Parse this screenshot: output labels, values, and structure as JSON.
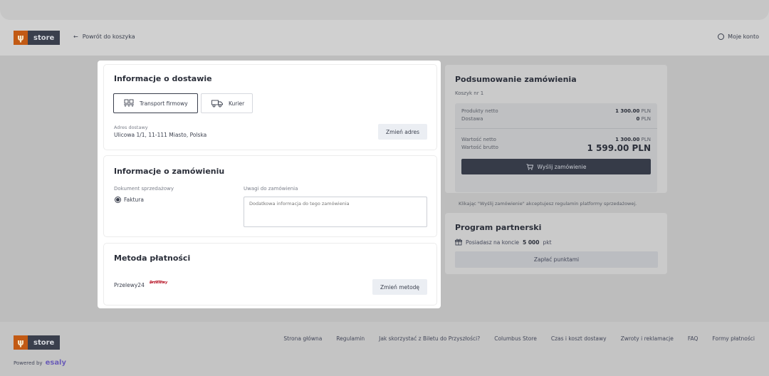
{
  "header": {
    "logo_text": "store",
    "back_label": "Powrót do koszyka",
    "account_label": "Moje konto"
  },
  "delivery": {
    "title": "Informacje o dostawie",
    "options": [
      {
        "label": "Transport firmowy",
        "selected": true,
        "icon": "pallet-icon"
      },
      {
        "label": "Kurier",
        "selected": false,
        "icon": "truck-icon"
      }
    ],
    "address_label": "Adres dostawy",
    "address_value": "Ulicowa 1/1, 11-111 Miasto, Polska",
    "change_address": "Zmień adres"
  },
  "order_info": {
    "title": "Informacje o zamówieniu",
    "doc_label": "Dokument sprzedażowy",
    "doc_value": "Faktura",
    "notes_label": "Uwagi do zamówienia",
    "notes_placeholder": "Dodatkowa informacja do tego zamówienia"
  },
  "payment": {
    "title": "Metoda płatności",
    "method": "Przelewy24",
    "method_logo_text": "Przelewy",
    "change_method": "Zmień metodę"
  },
  "summary": {
    "title": "Podsumowanie zamówienia",
    "cart_label": "Koszyk nr 1",
    "net_label": "Produkty netto",
    "net_amount": "1 300.00",
    "net_currency": "PLN",
    "delivery_label": "Dostawa",
    "delivery_amount": "0",
    "delivery_currency": "PLN",
    "total_net_label": "Wartość netto",
    "total_net_amount": "1 300.00",
    "total_net_currency": "PLN",
    "total_gross_label": "Wartość brutto",
    "total_gross": "1 599.00 PLN",
    "send_button": "Wyślij zamówienie",
    "terms_text": "Klikając \"Wyślij zamówienie\" akceptujesz regulamin platformy sprzedażowej."
  },
  "partner": {
    "title": "Program partnerski",
    "points_prefix": "Posiadasz na koncie",
    "points_value": "5 000",
    "points_unit": "pkt",
    "pay_button": "Zapłać punktami"
  },
  "footer": {
    "logo_text": "store",
    "powered_label": "Powered by",
    "powered_brand": "esaly",
    "links": [
      "Strona główna",
      "Regulamin",
      "Jak skorzystać z Biletu do Przyszłości?",
      "Columbus Store",
      "Czas i koszt dostawy",
      "Zwroty i reklamacje",
      "FAQ",
      "Formy płatności"
    ]
  },
  "colors": {
    "brand_orange": "#c25a14",
    "dark_navy": "#363b48",
    "overlay_gray": "#bdbdbd"
  }
}
